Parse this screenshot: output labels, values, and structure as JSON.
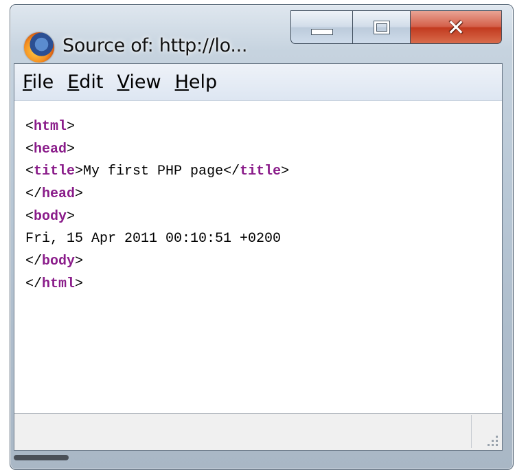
{
  "window": {
    "title": "Source of: http://lo...",
    "icon": "firefox-icon"
  },
  "menu": [
    {
      "mnemonic": "F",
      "rest": "ile"
    },
    {
      "mnemonic": "E",
      "rest": "dit"
    },
    {
      "mnemonic": "V",
      "rest": "iew"
    },
    {
      "mnemonic": "H",
      "rest": "elp"
    }
  ],
  "source": {
    "lines": [
      {
        "open": "<",
        "tag": "html",
        "text": ">",
        "close_tag": "",
        "end": ""
      },
      {
        "open": "<",
        "tag": "head",
        "text": ">",
        "close_tag": "",
        "end": ""
      },
      {
        "open": "<",
        "tag": "title",
        "text": ">My first PHP page</",
        "close_tag": "title",
        "end": ">"
      },
      {
        "open": "</",
        "tag": "head",
        "text": ">",
        "close_tag": "",
        "end": ""
      },
      {
        "open": "<",
        "tag": "body",
        "text": ">",
        "close_tag": "",
        "end": ""
      },
      {
        "open": "",
        "tag": "",
        "text": "Fri, 15 Apr 2011 00:10:51 +0200",
        "close_tag": "",
        "end": ""
      },
      {
        "open": "</",
        "tag": "body",
        "text": ">",
        "close_tag": "",
        "end": ""
      },
      {
        "open": "</",
        "tag": "html",
        "text": ">",
        "close_tag": "",
        "end": ""
      }
    ]
  },
  "colors": {
    "tag": "#8a1c8a",
    "close_button": "#c23a1f"
  }
}
